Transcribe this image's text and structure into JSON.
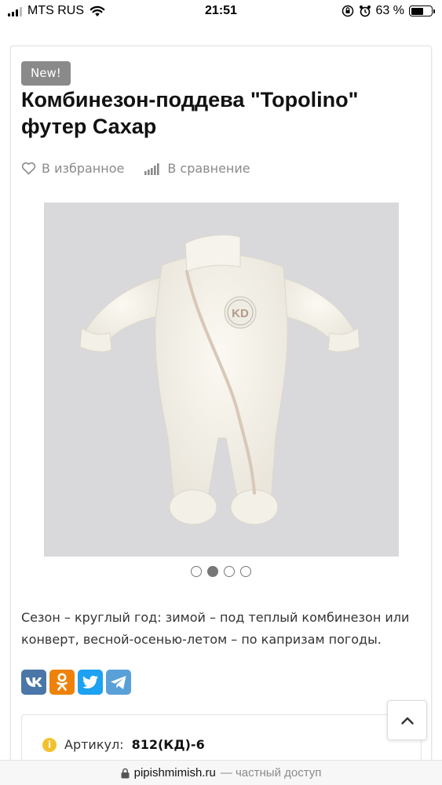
{
  "status_bar": {
    "carrier": "MTS RUS",
    "time": "21:51",
    "battery_percent": "63 %",
    "battery_level": 0.63
  },
  "product": {
    "badge": "New!",
    "title": "Комбинезон-поддева \"Topolino\" футер Сахар",
    "favorite_label": "В избранное",
    "compare_label": "В сравнение",
    "image_label": "KD",
    "gallery_count": 4,
    "gallery_active_index": 1,
    "description": "Сезон – круглый год: зимой – под теплый комбинезон или конверт, весной-осенью-летом – по капризам погоды.",
    "share_icons": [
      "vk-icon",
      "odnoklassniki-icon",
      "twitter-icon",
      "telegram-icon"
    ],
    "article_label": "Артикул:",
    "article_value": "812(КД)-6"
  },
  "browser": {
    "domain": "pipishmimish.ru",
    "note": "— частный доступ"
  },
  "colors": {
    "badge_bg": "#8a8a8a",
    "vk": "#4a76a8",
    "odnoklassniki": "#ee8208",
    "twitter": "#1da1f2",
    "telegram": "#5aa0d8",
    "image_bg": "#d9d9dc",
    "info_icon": "#f2c12e"
  }
}
